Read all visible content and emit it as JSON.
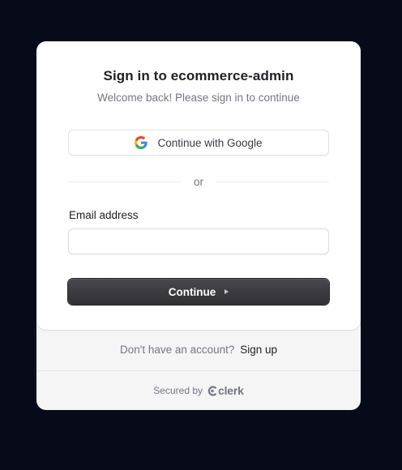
{
  "signin": {
    "title": "Sign in to ecommerce-admin",
    "subtitle": "Welcome back! Please sign in to continue",
    "google_button_label": "Continue with Google",
    "divider_text": "or",
    "email_label": "Email address",
    "email_value": "",
    "continue_label": "Continue"
  },
  "footer": {
    "signup_prompt": "Don't have an account?",
    "signup_link": "Sign up",
    "secured_by": "Secured by",
    "brand_name": "clerk"
  },
  "icons": {
    "google": "google-g-icon",
    "continue_arrow": "triangle-right-icon",
    "clerk_logo": "clerk-logo-icon"
  },
  "colors": {
    "page_background": "#070a18",
    "card_background": "#ffffff",
    "footer_background": "#f5f5f5",
    "primary_button": "#2f2f34",
    "title_text": "#212126",
    "muted_text": "#747686"
  }
}
